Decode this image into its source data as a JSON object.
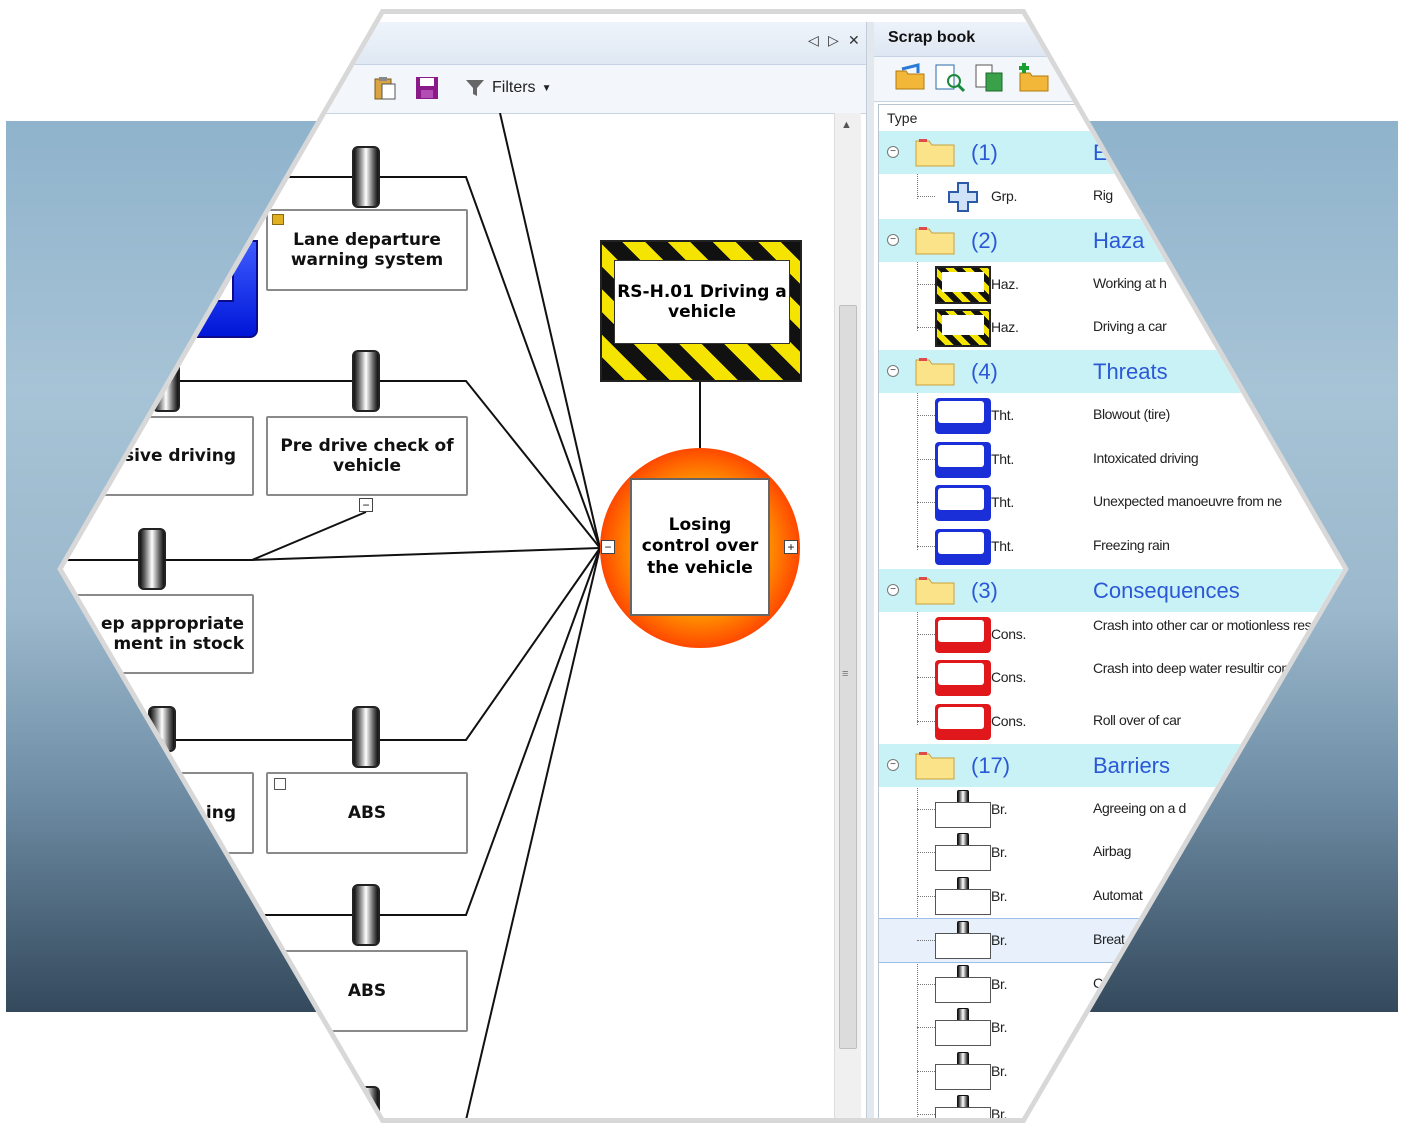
{
  "diagram": {
    "window_controls": [
      "◁",
      "▷",
      "✕"
    ],
    "filters_label": "Filters",
    "hazard": "RS-H.01 Driving a vehicle",
    "top_event": "Losing control over the vehicle",
    "nodes": {
      "lane_departure": "Lane departure warning system",
      "defensive_driving": "sive driving",
      "pre_drive_check": "Pre drive check of vehicle",
      "keep_equipment": "ep appropriate\nment in stock",
      "abs_1": "ABS",
      "abs_2": "ABS",
      "left_ing": "ing"
    }
  },
  "scrapbook": {
    "title": "Scrap book",
    "column_type": "Type",
    "groups": [
      {
        "count": "(1)",
        "name": "E",
        "items": [
          {
            "type": "Grp.",
            "desc": "Rig"
          }
        ]
      },
      {
        "count": "(2)",
        "name": "Haza",
        "items": [
          {
            "type": "Haz.",
            "desc": "Working at h"
          },
          {
            "type": "Haz.",
            "desc": "Driving a car"
          }
        ]
      },
      {
        "count": "(4)",
        "name": "Threats",
        "items": [
          {
            "type": "Tht.",
            "desc": "Blowout (tire)"
          },
          {
            "type": "Tht.",
            "desc": "Intoxicated driving"
          },
          {
            "type": "Tht.",
            "desc": "Unexpected manoeuvre from ne"
          },
          {
            "type": "Tht.",
            "desc": "Freezing rain"
          }
        ]
      },
      {
        "count": "(3)",
        "name": "Consequences",
        "items": [
          {
            "type": "Cons.",
            "desc": "Crash into other car or motionless resulting in injury"
          },
          {
            "type": "Cons.",
            "desc": "Crash into deep water resultir confined space"
          },
          {
            "type": "Cons.",
            "desc": "Roll over of car"
          }
        ]
      },
      {
        "count": "(17)",
        "name": "Barriers",
        "items": [
          {
            "type": "Br.",
            "desc": "Agreeing on a d"
          },
          {
            "type": "Br.",
            "desc": "Airbag"
          },
          {
            "type": "Br.",
            "desc": "Automat"
          },
          {
            "type": "Br.",
            "desc": "Breat"
          },
          {
            "type": "Br.",
            "desc": "Ch"
          },
          {
            "type": "Br.",
            "desc": ""
          },
          {
            "type": "Br.",
            "desc": ""
          },
          {
            "type": "Br.",
            "desc": ""
          }
        ]
      }
    ]
  },
  "colors": {
    "accent_blue": "#2b58d6",
    "group_row": "#c9f2f7",
    "threat": "#1a2fd8",
    "consequence": "#e0171b",
    "hazard_yellow": "#f5e400"
  },
  "icons": [
    "folder-icon",
    "group-cross-icon",
    "filter-icon",
    "save-icon",
    "paste-icon",
    "open-folder-icon",
    "preview-icon",
    "export-icon",
    "add-folder-icon"
  ]
}
